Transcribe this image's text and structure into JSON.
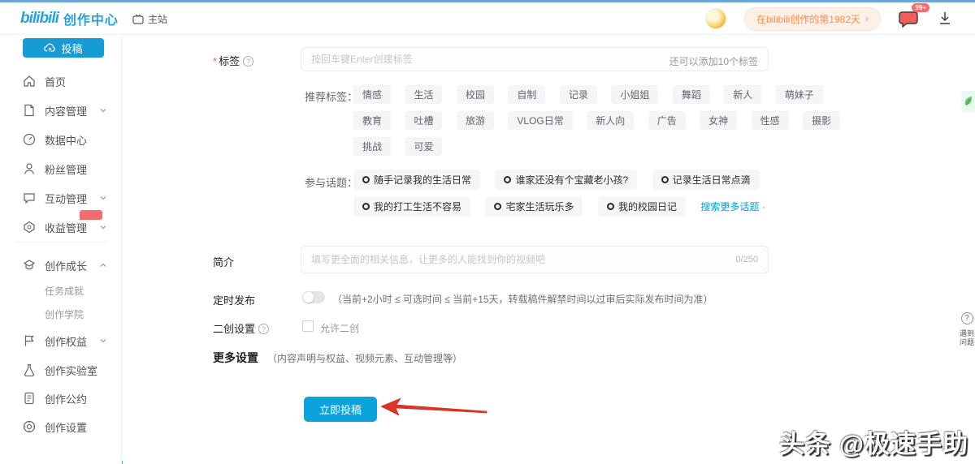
{
  "topbar": {
    "logo": "bilibili",
    "title": "创作中心",
    "main_site": "主站",
    "streak_badge": "在bilibili创作的第1982天",
    "streak_chevron": "›",
    "message_badge": "99+"
  },
  "sidebar": {
    "submit_button": "投稿",
    "items": [
      {
        "label": "首页"
      },
      {
        "label": "内容管理"
      },
      {
        "label": "数据中心"
      },
      {
        "label": "粉丝管理"
      },
      {
        "label": "互动管理"
      },
      {
        "label": "收益管理"
      },
      {
        "label": "创作成长"
      },
      {
        "label": "创作权益"
      },
      {
        "label": "创作实验室"
      },
      {
        "label": "创作公约"
      },
      {
        "label": "创作设置"
      }
    ],
    "sub_items": [
      {
        "label": "任务成就"
      },
      {
        "label": "创作学院"
      }
    ]
  },
  "form": {
    "tag_label": "标签",
    "tag_required": "*",
    "tag_placeholder": "按回车键Enter创建标签",
    "tag_limit": "还可以添加10个标签",
    "recommend_label": "推荐标签：",
    "tags_row1": [
      "情感",
      "生活",
      "校园",
      "自制",
      "记录",
      "小姐姐",
      "舞蹈",
      "新人",
      "萌妹子"
    ],
    "tags_row2": [
      "教育",
      "吐槽",
      "旅游",
      "VLOG日常",
      "新人向",
      "广告",
      "女神",
      "性感",
      "摄影"
    ],
    "tags_row3": [
      "挑战",
      "可爱"
    ],
    "topic_label": "参与话题：",
    "topics_row1": [
      "随手记录我的生活日常",
      "谁家还没有个宝藏老小孩?",
      "记录生活日常点滴"
    ],
    "topics_row2": [
      "我的打工生活不容易",
      "宅家生活玩乐多",
      "我的校园日记"
    ],
    "topic_more": "搜索更多话题 ·",
    "desc_label": "简介",
    "desc_placeholder": "填写更全面的相关信息，让更多的人能找到你的视频吧",
    "desc_count": "0/250",
    "schedule_label": "定时发布",
    "schedule_hint": "（当前+2小时 ≤ 可选时间 ≤ 当前+15天，转载稿件解禁时间以过审后实际发布时间为准）",
    "second_label": "二创设置",
    "second_checkbox_label": "允许二创",
    "more_label": "更多设置",
    "more_hint": "（内容声明与权益、视频元素、互动管理等）",
    "submit_button": "立即投稿"
  },
  "overlay": {
    "watermark": "头条 @极速手助",
    "help_line1": "遇到",
    "help_line2": "问题"
  },
  "colors": {
    "accent": "#00a1d6",
    "arrow_red": "#e23c2e",
    "badge_red": "#f56c6c",
    "streak_orange": "#ff8c4c"
  }
}
